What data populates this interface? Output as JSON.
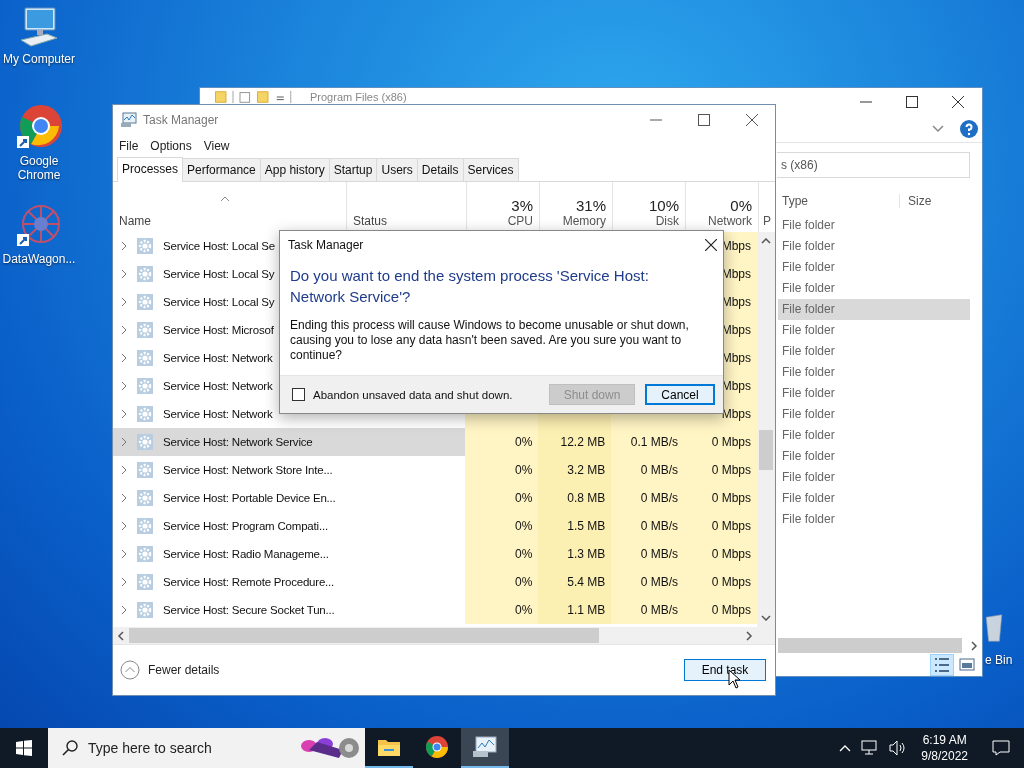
{
  "desktop": {
    "icons": [
      {
        "kind": "computer",
        "label": "My Computer"
      },
      {
        "kind": "chrome",
        "label": "Google Chrome"
      },
      {
        "kind": "datawagon",
        "label": "DataWagon..."
      }
    ],
    "recycle_label": "e Bin"
  },
  "explorer": {
    "title": "Program Files (x86)",
    "address": "s (x86)",
    "columns": [
      "Type",
      "Size"
    ],
    "rows": [
      {
        "type": "File folder",
        "selected": false
      },
      {
        "type": "File folder",
        "selected": false
      },
      {
        "type": "File folder",
        "selected": false
      },
      {
        "type": "File folder",
        "selected": false
      },
      {
        "type": "File folder",
        "selected": true
      },
      {
        "type": "File folder",
        "selected": false
      },
      {
        "type": "File folder",
        "selected": false
      },
      {
        "type": "File folder",
        "selected": false
      },
      {
        "type": "File folder",
        "selected": false
      },
      {
        "type": "File folder",
        "selected": false
      },
      {
        "type": "File folder",
        "selected": false
      },
      {
        "type": "File folder",
        "selected": false
      },
      {
        "type": "File folder",
        "selected": false
      },
      {
        "type": "File folder",
        "selected": false
      },
      {
        "type": "File folder",
        "selected": false
      }
    ]
  },
  "task_manager": {
    "title": "Task Manager",
    "menu": [
      "File",
      "Options",
      "View"
    ],
    "tabs": [
      {
        "label": "Processes",
        "selected": true
      },
      {
        "label": "Performance",
        "selected": false
      },
      {
        "label": "App history",
        "selected": false
      },
      {
        "label": "Startup",
        "selected": false
      },
      {
        "label": "Users",
        "selected": false
      },
      {
        "label": "Details",
        "selected": false
      },
      {
        "label": "Services",
        "selected": false
      }
    ],
    "name_column": "Name",
    "status_column": "Status",
    "usage_columns": [
      {
        "usage": "3%",
        "label": "CPU"
      },
      {
        "usage": "31%",
        "label": "Memory"
      },
      {
        "usage": "10%",
        "label": "Disk"
      },
      {
        "usage": "0%",
        "label": "Network"
      }
    ],
    "cut_column": "P",
    "rows": [
      {
        "name": "Service Host: Local Se",
        "network": "Mbps",
        "selected": false
      },
      {
        "name": "Service Host: Local Sy",
        "network": "Mbps",
        "selected": false
      },
      {
        "name": "Service Host: Local Sy",
        "network": "Mbps",
        "selected": false
      },
      {
        "name": "Service Host: Microsof",
        "network": "Mbps",
        "selected": false
      },
      {
        "name": "Service Host: Network",
        "network": "Mbps",
        "selected": false
      },
      {
        "name": "Service Host: Network",
        "network": "Mbps",
        "selected": false
      },
      {
        "name": "Service Host: Network",
        "network": "Mbps",
        "selected": false
      },
      {
        "name": "Service Host: Network Service",
        "cpu": "0%",
        "memory": "12.2 MB",
        "disk": "0.1 MB/s",
        "network": "0 Mbps",
        "selected": true
      },
      {
        "name": "Service Host: Network Store Inte...",
        "cpu": "0%",
        "memory": "3.2 MB",
        "disk": "0 MB/s",
        "network": "0 Mbps",
        "selected": false
      },
      {
        "name": "Service Host: Portable Device En...",
        "cpu": "0%",
        "memory": "0.8 MB",
        "disk": "0 MB/s",
        "network": "0 Mbps",
        "selected": false
      },
      {
        "name": "Service Host: Program Compati...",
        "cpu": "0%",
        "memory": "1.5 MB",
        "disk": "0 MB/s",
        "network": "0 Mbps",
        "selected": false
      },
      {
        "name": "Service Host: Radio Manageme...",
        "cpu": "0%",
        "memory": "1.3 MB",
        "disk": "0 MB/s",
        "network": "0 Mbps",
        "selected": false
      },
      {
        "name": "Service Host: Remote Procedure...",
        "cpu": "0%",
        "memory": "5.4 MB",
        "disk": "0 MB/s",
        "network": "0 Mbps",
        "selected": false
      },
      {
        "name": "Service Host: Secure Socket Tun...",
        "cpu": "0%",
        "memory": "1.1 MB",
        "disk": "0 MB/s",
        "network": "0 Mbps",
        "selected": false
      }
    ],
    "fewer_details": "Fewer details",
    "end_task": "End task"
  },
  "dialog": {
    "title": "Task Manager",
    "heading": "Do you want to end the system process 'Service Host: Network Service'?",
    "message": "Ending this process will cause Windows to become unusable or shut down, causing you to lose any data hasn't been saved. Are you sure you want to continue?",
    "checkbox": {
      "label": "Abandon unsaved data and shut down.",
      "checked": false
    },
    "buttons": [
      {
        "label": "Shut down",
        "disabled": true
      },
      {
        "label": "Cancel",
        "disabled": false
      }
    ]
  },
  "taskbar": {
    "search_placeholder": "Type here to search",
    "apps": [
      {
        "kind": "folder",
        "running": true,
        "selected": false
      },
      {
        "kind": "chrome",
        "running": false,
        "selected": false
      },
      {
        "kind": "taskmanager",
        "running": true,
        "selected": true
      }
    ],
    "time": "6:19 AM",
    "date": "9/8/2022"
  }
}
